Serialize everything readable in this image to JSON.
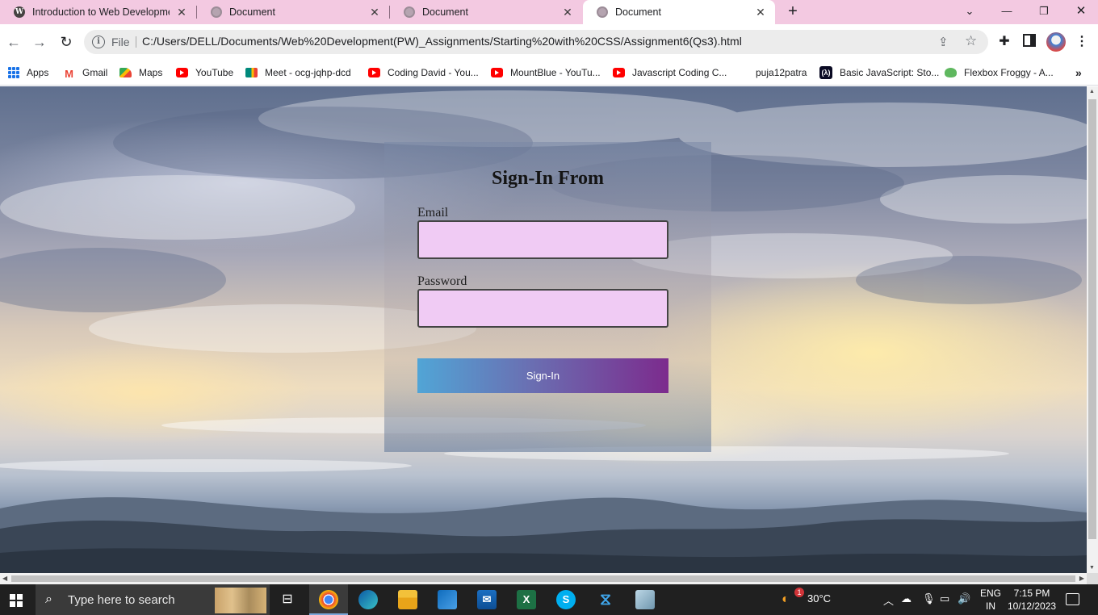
{
  "browser": {
    "tabs": [
      {
        "title": "Introduction to Web Developme",
        "icon": "wordpress-icon",
        "active": false
      },
      {
        "title": "Document",
        "icon": "globe-icon",
        "active": false
      },
      {
        "title": "Document",
        "icon": "globe-icon",
        "active": false
      },
      {
        "title": "Document",
        "icon": "globe-icon",
        "active": true
      }
    ],
    "new_tab_icon": "plus-icon",
    "window_controls": {
      "minimize": "—",
      "restore": "❐",
      "close": "✕",
      "tab_search": "⌄"
    },
    "nav": {
      "back": "←",
      "forward": "→",
      "reload": "↻"
    },
    "omnibox": {
      "info_icon": "info-icon",
      "scheme_label": "File",
      "url": "C:/Users/DELL/Documents/Web%20Development(PW)_Assignments/Starting%20with%20CSS/Assignment6(Qs3).html"
    },
    "bookmarks": [
      {
        "label": "Apps",
        "icon": "apps-grid-icon"
      },
      {
        "label": "Gmail",
        "icon": "gmail-icon"
      },
      {
        "label": "Maps",
        "icon": "maps-icon"
      },
      {
        "label": "YouTube",
        "icon": "youtube-icon"
      },
      {
        "label": "Meet - ocg-jqhp-dcd",
        "icon": "meet-icon"
      },
      {
        "label": "Coding David - You...",
        "icon": "youtube-icon"
      },
      {
        "label": "MountBlue - YouTu...",
        "icon": "youtube-icon"
      },
      {
        "label": "Javascript Coding C...",
        "icon": "youtube-icon"
      },
      {
        "label": "puja12patra",
        "icon": ""
      },
      {
        "label": "Basic JavaScript: Sto...",
        "icon": "freecodecamp-icon"
      },
      {
        "label": "Flexbox Froggy - A...",
        "icon": "frog-icon"
      }
    ],
    "bookmarks_overflow": "»"
  },
  "page": {
    "form_title": "Sign-In From",
    "email_label": "Email",
    "email_value": "",
    "password_label": "Password",
    "password_value": "",
    "submit_label": "Sign-In"
  },
  "taskbar": {
    "search_placeholder": "Type here to search",
    "weather": "30°C",
    "language_top": "ENG",
    "language_bottom": "IN",
    "time": "7:15 PM",
    "date": "10/12/2023",
    "weather_badge": "1"
  },
  "colors": {
    "tab_strip": "#f3c9e1",
    "input_bg": "#f0cbf4",
    "button_gradient_start": "#51a5d6",
    "button_gradient_end": "#7c2b8d",
    "taskbar": "#202020"
  }
}
